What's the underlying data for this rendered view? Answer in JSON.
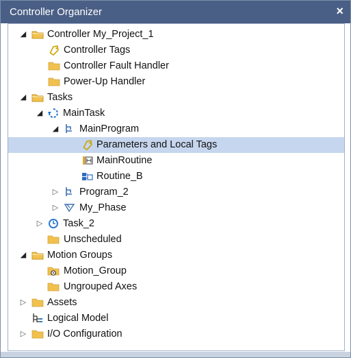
{
  "window": {
    "title": "Controller Organizer",
    "close_glyph": "×"
  },
  "tree": {
    "controller": {
      "label": "Controller My_Project_1",
      "icon": "folder-open-icon"
    },
    "controller_tags": {
      "label": "Controller Tags",
      "icon": "tag-icon"
    },
    "fault_handler": {
      "label": "Controller Fault Handler",
      "icon": "folder-icon"
    },
    "powerup_handler": {
      "label": "Power-Up Handler",
      "icon": "folder-icon"
    },
    "tasks": {
      "label": "Tasks",
      "icon": "folder-open-icon"
    },
    "main_task": {
      "label": "MainTask",
      "icon": "continuous-task-icon"
    },
    "main_program": {
      "label": "MainProgram",
      "icon": "program-icon"
    },
    "params_local_tags": {
      "label": "Parameters and Local Tags",
      "icon": "tag-icon"
    },
    "main_routine": {
      "label": "MainRoutine",
      "icon": "ladder-routine-icon"
    },
    "routine_b": {
      "label": "Routine_B",
      "icon": "function-block-routine-icon"
    },
    "program_2": {
      "label": "Program_2",
      "icon": "program-icon"
    },
    "my_phase": {
      "label": "My_Phase",
      "icon": "phase-icon"
    },
    "task_2": {
      "label": "Task_2",
      "icon": "periodic-task-icon"
    },
    "unscheduled": {
      "label": "Unscheduled",
      "icon": "folder-icon"
    },
    "motion_groups": {
      "label": "Motion Groups",
      "icon": "folder-open-icon"
    },
    "motion_group": {
      "label": "Motion_Group",
      "icon": "motion-group-icon"
    },
    "ungrouped_axes": {
      "label": "Ungrouped Axes",
      "icon": "folder-icon"
    },
    "assets": {
      "label": "Assets",
      "icon": "folder-icon"
    },
    "logical_model": {
      "label": "Logical Model",
      "icon": "logical-model-icon"
    },
    "io_configuration": {
      "label": "I/O Configuration",
      "icon": "folder-icon"
    }
  },
  "colors": {
    "titlebar": "#4a5f86",
    "selection": "#c6d6ee",
    "folder": "#f0c14e",
    "tag_outline": "#c9a400"
  }
}
